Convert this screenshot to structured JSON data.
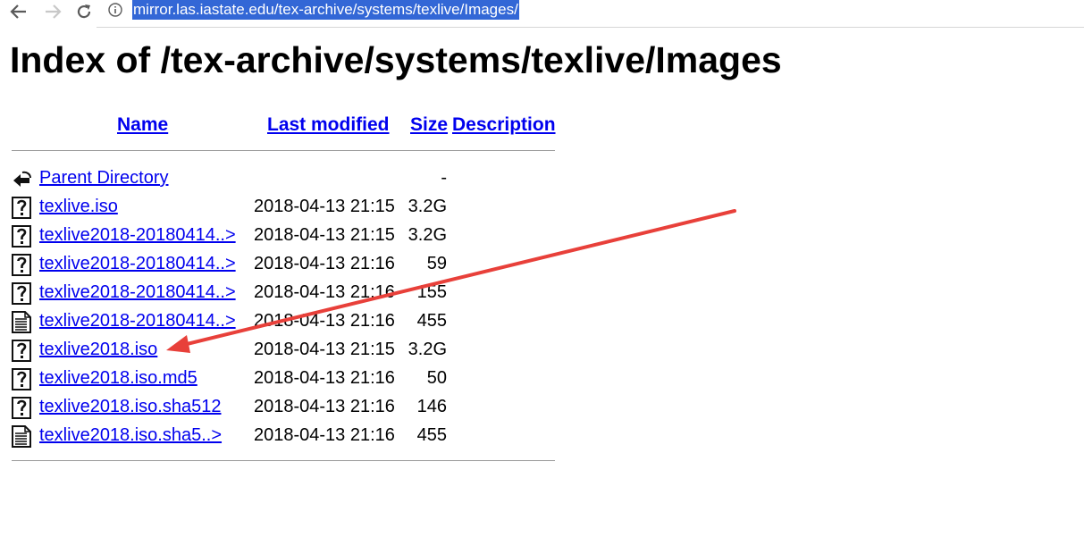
{
  "browser": {
    "url": "mirror.las.iastate.edu/tex-archive/systems/texlive/Images/"
  },
  "page": {
    "title": "Index of /tex-archive/systems/texlive/Images",
    "columns": {
      "name": "Name",
      "last_modified": "Last modified",
      "size": "Size",
      "description": "Description"
    },
    "rows": [
      {
        "icon": "parent-directory-icon",
        "name": "Parent Directory",
        "date": "",
        "size": "-"
      },
      {
        "icon": "unknown-file-icon",
        "name": "texlive.iso",
        "date": "2018-04-13 21:15",
        "size": "3.2G"
      },
      {
        "icon": "unknown-file-icon",
        "name": "texlive2018-20180414..>",
        "date": "2018-04-13 21:15",
        "size": "3.2G"
      },
      {
        "icon": "unknown-file-icon",
        "name": "texlive2018-20180414..>",
        "date": "2018-04-13 21:16",
        "size": "59"
      },
      {
        "icon": "unknown-file-icon",
        "name": "texlive2018-20180414..>",
        "date": "2018-04-13 21:16",
        "size": "155"
      },
      {
        "icon": "text-file-icon",
        "name": "texlive2018-20180414..>",
        "date": "2018-04-13 21:16",
        "size": "455"
      },
      {
        "icon": "unknown-file-icon",
        "name": "texlive2018.iso",
        "date": "2018-04-13 21:15",
        "size": "3.2G"
      },
      {
        "icon": "unknown-file-icon",
        "name": "texlive2018.iso.md5",
        "date": "2018-04-13 21:16",
        "size": "50"
      },
      {
        "icon": "unknown-file-icon",
        "name": "texlive2018.iso.sha512",
        "date": "2018-04-13 21:16",
        "size": "146"
      },
      {
        "icon": "text-file-icon",
        "name": "texlive2018.iso.sha5..>",
        "date": "2018-04-13 21:16",
        "size": "455"
      }
    ]
  },
  "annotation": {
    "arrow_color": "#e8403a",
    "link_color": "#0000ee",
    "url_highlight_color": "#3367d6"
  }
}
